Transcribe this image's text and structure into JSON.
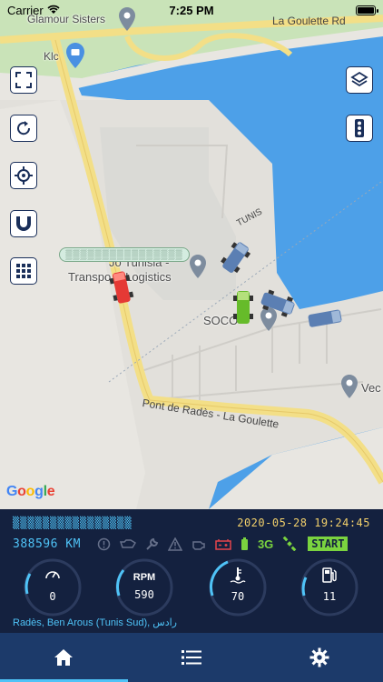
{
  "status_bar": {
    "carrier": "Carrier",
    "time": "7:25 PM"
  },
  "map": {
    "places": {
      "glamour": "Glamour Sisters",
      "klc": "Klc",
      "transport_top": "Jo  Tunisia -",
      "transport_bottom": "Transpo  & Logistics",
      "socoo": "SOCO",
      "vec": "Vec"
    },
    "roads": {
      "la_goulette_rd": "La Goulette Rd",
      "tunis": "TUNIS",
      "pont": "Pont de Radès - La Goulette"
    },
    "google": [
      "G",
      "o",
      "o",
      "g",
      "l",
      "e"
    ],
    "controls": {
      "fullscreen": "fullscreen-icon",
      "refresh": "refresh-icon",
      "locate": "crosshair-icon",
      "magnet": "magnet-icon",
      "grid": "grid-icon",
      "layers": "layers-icon",
      "traffic": "traffic-light-icon"
    }
  },
  "vehicle": {
    "date": "2020-05-28 19:24:45",
    "odometer": "388596 KM",
    "network": "3G",
    "state": "START"
  },
  "gauges": [
    {
      "label": "",
      "value": "0",
      "icon": "speedometer-icon"
    },
    {
      "label": "RPM",
      "value": "590",
      "icon": ""
    },
    {
      "label": "",
      "value": "70",
      "icon": "coolant-temp-icon"
    },
    {
      "label": "",
      "value": "11",
      "icon": "fuel-icon"
    }
  ],
  "address": "Radès, Ben Arous (Tunis Sud), رادس",
  "tabs": [
    {
      "name": "home",
      "icon": "home-icon",
      "active": true
    },
    {
      "name": "list",
      "icon": "list-icon",
      "active": false
    },
    {
      "name": "settings",
      "icon": "gear-icon",
      "active": false
    }
  ],
  "colors": {
    "panel": "#14213f",
    "accent": "#4fc3f7",
    "date": "#f2d06b",
    "ok": "#7ad33f",
    "alert": "#e5444b",
    "tabbar": "#1c3a6a",
    "water": "#4da0e8"
  }
}
